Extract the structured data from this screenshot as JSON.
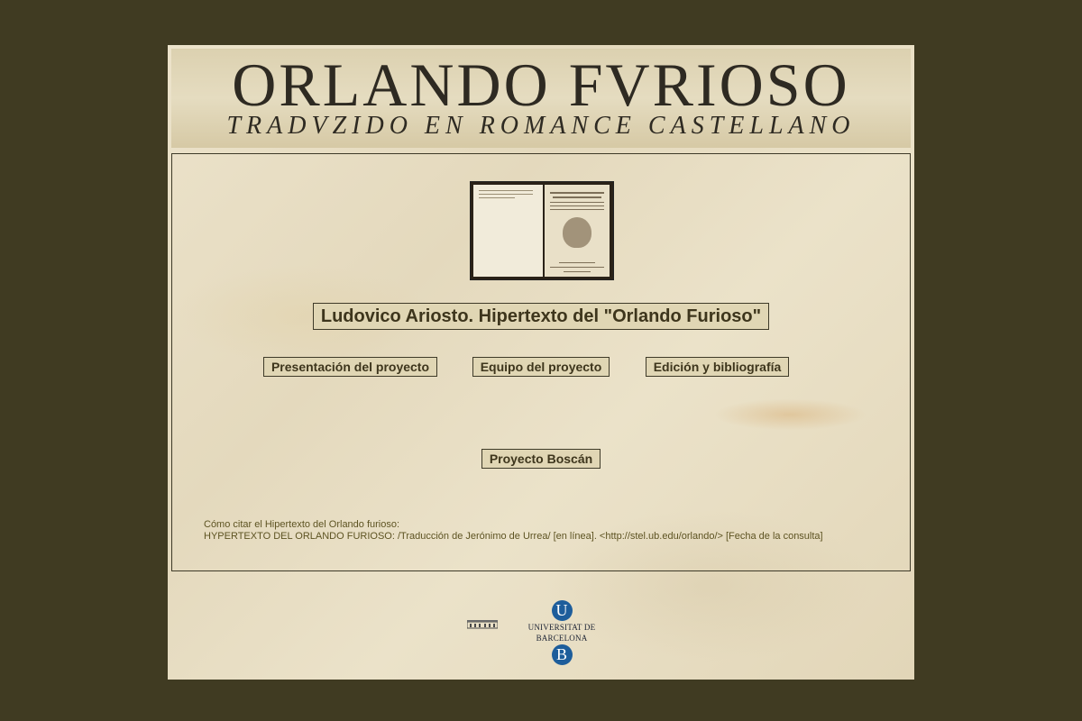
{
  "header": {
    "title": "ORLANDO FVRIOSO",
    "subtitle": "TRADVZIDO EN ROMANCE CASTELLANO"
  },
  "main": {
    "title": "Ludovico Ariosto. Hipertexto del \"Orlando Furioso\"",
    "nav": [
      {
        "label": "Presentación del proyecto"
      },
      {
        "label": "Equipo del proyecto"
      },
      {
        "label": "Edición y bibliografía"
      }
    ],
    "boscan_button": "Proyecto Boscán"
  },
  "citation": {
    "heading": "Cómo citar el Hipertexto del Orlando furioso:",
    "text": "HYPERTEXTO DEL ORLANDO FURIOSO: /Traducción de Jerónimo de Urrea/ [en línea]. <http://stel.ub.edu/orlando/> [Fecha de la consulta]"
  },
  "footer": {
    "ub_letter_top": "U",
    "ub_name": "UNIVERSITAT DE BARCELONA",
    "ub_letter_bottom": "B"
  },
  "colors": {
    "outer_background": "#403b22",
    "button_background": "#e0d6b4",
    "button_text": "#3d351c",
    "ub_blue": "#1d5d9b"
  }
}
